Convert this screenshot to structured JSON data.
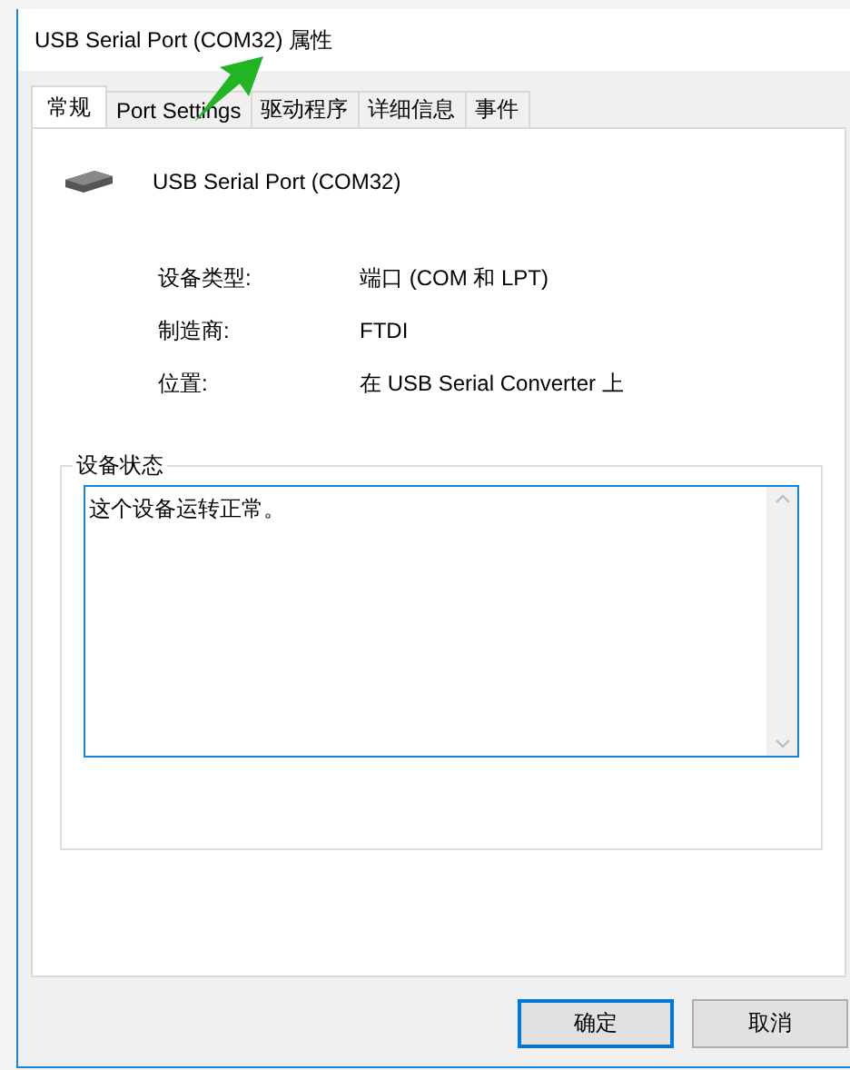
{
  "window": {
    "title": "USB Serial Port (COM32) 属性"
  },
  "tabs": [
    {
      "label": "常规",
      "selected": true
    },
    {
      "label": "Port Settings",
      "selected": false
    },
    {
      "label": "驱动程序",
      "selected": false
    },
    {
      "label": "详细信息",
      "selected": false
    },
    {
      "label": "事件",
      "selected": false
    }
  ],
  "device": {
    "name": "USB Serial Port (COM32)"
  },
  "properties": [
    {
      "label": "设备类型:",
      "value": "端口 (COM 和 LPT)"
    },
    {
      "label": "制造商:",
      "value": "FTDI"
    },
    {
      "label": "位置:",
      "value": "在 USB Serial Converter 上"
    }
  ],
  "device_status": {
    "title": "设备状态",
    "text": "这个设备运转正常。"
  },
  "buttons": [
    {
      "label": "确定",
      "selected": true
    },
    {
      "label": "取消",
      "selected": false
    }
  ]
}
